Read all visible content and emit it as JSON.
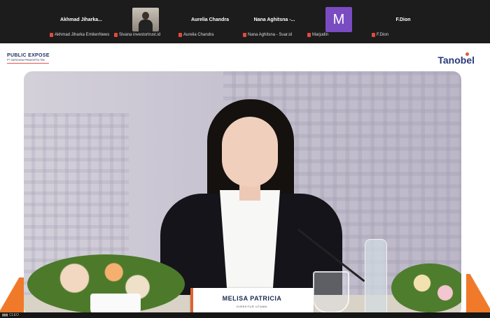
{
  "participants": [
    {
      "name": "Akhmad  Jiharka...",
      "label": "Akhmad Jiharka EmitenNews",
      "video": false
    },
    {
      "name": "",
      "label": "Sivana investortrust.id",
      "video": true
    },
    {
      "name": "Aurelia Chandra",
      "label": "Aurelia Chandra",
      "video": false
    },
    {
      "name": "Nana Aghitsna -...",
      "label": "Nana Aghitsna - Suar.id",
      "video": false
    },
    {
      "name": "M",
      "label": "Marjudin",
      "video": false,
      "avatar_color": "#7a4cc2"
    },
    {
      "name": "F.Dion",
      "label": "F.Dion",
      "video": false
    }
  ],
  "slide": {
    "title": "PUBLIC EXPOSE",
    "subtitle": "PT SARIGUNA PRIMATIRTA TBK",
    "brand": "Tanobel"
  },
  "speaker": {
    "name": "MELISA PATRICIA",
    "role": "DIREKTUR UTAMA"
  },
  "status": {
    "signal_label": "CLEO"
  },
  "colors": {
    "accent": "#f07a2a",
    "mic_muted": "#e24a3b",
    "avatar": "#7a4cc2"
  }
}
